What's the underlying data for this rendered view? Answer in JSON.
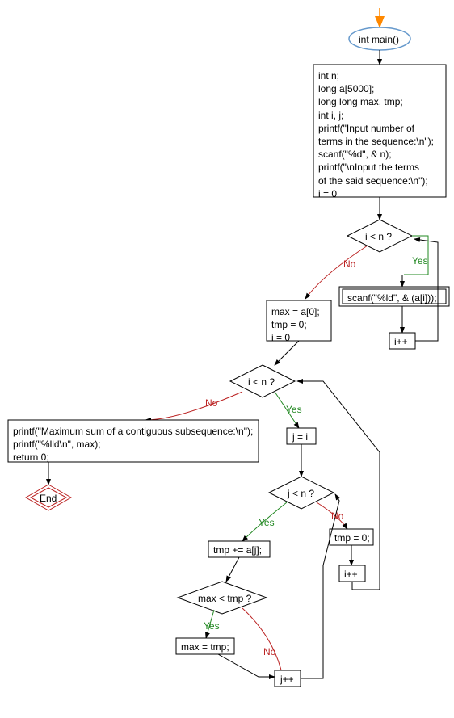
{
  "chart_data": {
    "type": "flowchart",
    "nodes": {
      "start_arrow": "↓",
      "main_fn": "int main()",
      "declarations": "int n;\nlong a[5000];\nlong long max, tmp;\nint i, j;\nprintf(\"Input number of\nterms in the sequence:\\n\");\nscanf(\"%d\", & n);\nprintf(\"\\nInput the terms\nof the said sequence:\\n\");\ni = 0",
      "cond_i_lt_n_1": "i < n ?",
      "scanf_ai": "scanf(\"%ld\", & (a[i]));",
      "i_plus_plus_1": "i++",
      "init_max": "max = a[0];\ntmp = 0;\ni = 0",
      "cond_i_lt_n_2": "i < n ?",
      "final_print": "printf(\"Maximum sum of a contiguous subsequence:\\n\");\nprintf(\"%lld\\n\", max);\nreturn 0;",
      "end": "End",
      "j_eq_i": "j = i",
      "cond_j_lt_n": "j < n ?",
      "tmp_plus_aj": "tmp += a[j];",
      "tmp_zero": "tmp = 0;",
      "i_plus_plus_2": "i++",
      "cond_max_lt_tmp": "max < tmp ?",
      "max_eq_tmp": "max = tmp;",
      "j_plus_plus": "j++"
    },
    "edges": [
      {
        "from": "cond_i_lt_n_1",
        "label": "No",
        "to": "init_max"
      },
      {
        "from": "cond_i_lt_n_1",
        "label": "Yes",
        "to": "scanf_ai"
      },
      {
        "from": "cond_i_lt_n_2",
        "label": "No",
        "to": "final_print"
      },
      {
        "from": "cond_i_lt_n_2",
        "label": "Yes",
        "to": "j_eq_i"
      },
      {
        "from": "cond_j_lt_n",
        "label": "Yes",
        "to": "tmp_plus_aj"
      },
      {
        "from": "cond_j_lt_n",
        "label": "No",
        "to": "tmp_zero"
      },
      {
        "from": "cond_max_lt_tmp",
        "label": "Yes",
        "to": "max_eq_tmp"
      },
      {
        "from": "cond_max_lt_tmp",
        "label": "No",
        "to": "j_plus_plus"
      }
    ],
    "labels": {
      "no": "No",
      "yes": "Yes"
    }
  }
}
